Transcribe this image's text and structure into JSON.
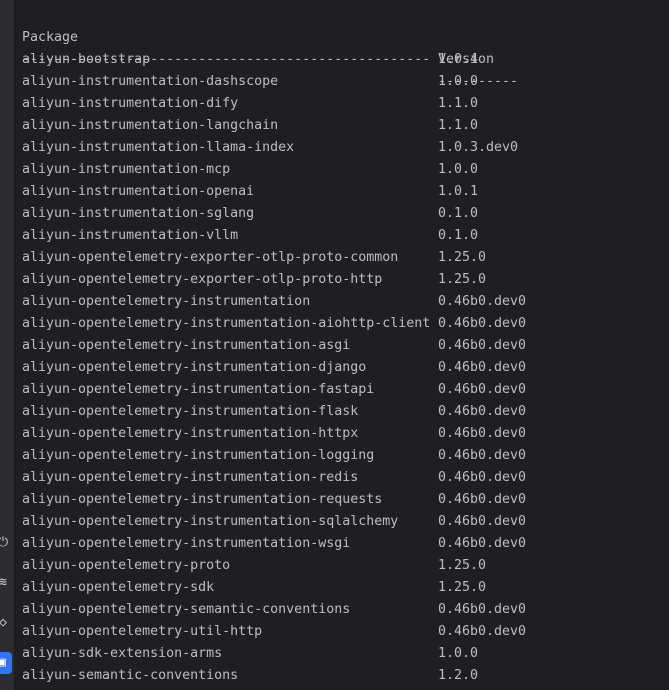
{
  "sidebar": {
    "icons": [
      "plug-icon",
      "layers-icon",
      "diamond-icon",
      "terminal-icon"
    ],
    "accent": "#3574f0"
  },
  "header": {
    "package": "Package",
    "version": "Version"
  },
  "separator": {
    "package": "---------------------------------------------------",
    "version": "----------"
  },
  "rows": [
    {
      "package": "aliyun-bootstrap",
      "version": "1.0.4"
    },
    {
      "package": "aliyun-instrumentation-dashscope",
      "version": "1.0.0"
    },
    {
      "package": "aliyun-instrumentation-dify",
      "version": "1.1.0"
    },
    {
      "package": "aliyun-instrumentation-langchain",
      "version": "1.1.0"
    },
    {
      "package": "aliyun-instrumentation-llama-index",
      "version": "1.0.3.dev0"
    },
    {
      "package": "aliyun-instrumentation-mcp",
      "version": "1.0.0"
    },
    {
      "package": "aliyun-instrumentation-openai",
      "version": "1.0.1"
    },
    {
      "package": "aliyun-instrumentation-sglang",
      "version": "0.1.0"
    },
    {
      "package": "aliyun-instrumentation-vllm",
      "version": "0.1.0"
    },
    {
      "package": "aliyun-opentelemetry-exporter-otlp-proto-common",
      "version": "1.25.0"
    },
    {
      "package": "aliyun-opentelemetry-exporter-otlp-proto-http",
      "version": "1.25.0"
    },
    {
      "package": "aliyun-opentelemetry-instrumentation",
      "version": "0.46b0.dev0"
    },
    {
      "package": "aliyun-opentelemetry-instrumentation-aiohttp-client",
      "version": "0.46b0.dev0"
    },
    {
      "package": "aliyun-opentelemetry-instrumentation-asgi",
      "version": "0.46b0.dev0"
    },
    {
      "package": "aliyun-opentelemetry-instrumentation-django",
      "version": "0.46b0.dev0"
    },
    {
      "package": "aliyun-opentelemetry-instrumentation-fastapi",
      "version": "0.46b0.dev0"
    },
    {
      "package": "aliyun-opentelemetry-instrumentation-flask",
      "version": "0.46b0.dev0"
    },
    {
      "package": "aliyun-opentelemetry-instrumentation-httpx",
      "version": "0.46b0.dev0"
    },
    {
      "package": "aliyun-opentelemetry-instrumentation-logging",
      "version": "0.46b0.dev0"
    },
    {
      "package": "aliyun-opentelemetry-instrumentation-redis",
      "version": "0.46b0.dev0"
    },
    {
      "package": "aliyun-opentelemetry-instrumentation-requests",
      "version": "0.46b0.dev0"
    },
    {
      "package": "aliyun-opentelemetry-instrumentation-sqlalchemy",
      "version": "0.46b0.dev0"
    },
    {
      "package": "aliyun-opentelemetry-instrumentation-wsgi",
      "version": "0.46b0.dev0"
    },
    {
      "package": "aliyun-opentelemetry-proto",
      "version": "1.25.0"
    },
    {
      "package": "aliyun-opentelemetry-sdk",
      "version": "1.25.0"
    },
    {
      "package": "aliyun-opentelemetry-semantic-conventions",
      "version": "0.46b0.dev0"
    },
    {
      "package": "aliyun-opentelemetry-util-http",
      "version": "0.46b0.dev0"
    },
    {
      "package": "aliyun-sdk-extension-arms",
      "version": "1.0.0"
    },
    {
      "package": "aliyun-semantic-conventions",
      "version": "1.2.0"
    }
  ]
}
